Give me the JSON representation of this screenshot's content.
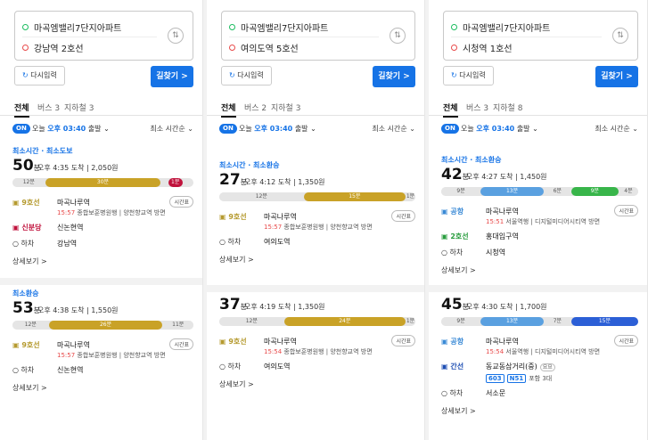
{
  "common": {
    "reset_label": "다시입력",
    "search_label": "길찾기 >",
    "swap_icon": "swap-icon",
    "on_badge": "ON",
    "today_prefix": "오늘",
    "depart_time": "오후 03:40",
    "depart_suffix": "출발",
    "sort_label": "최소 시간순",
    "tab_all": "전체",
    "timetable": "시간표",
    "more": "상세보기",
    "walk_off": "하차"
  },
  "panels": [
    {
      "origin": "마곡엠밸리7단지아파트",
      "destination": "강남역 2호선",
      "tabs": [
        "버스 3",
        "지하철 3"
      ],
      "routes": [
        {
          "tag": "최소시간 · 최소도보",
          "minutes": "50",
          "min_unit": "분",
          "arrive": "오후 4:35 도착",
          "fare": "2,050원",
          "segments": [
            {
              "label": "12분",
              "kind": "walk",
              "from": 0.0,
              "to": 0.18
            },
            {
              "label": "30분",
              "kind": "line9",
              "from": 0.18,
              "to": 0.82
            },
            {
              "label": "1분",
              "kind": "sinbundang",
              "from": 0.86,
              "to": 0.94
            }
          ],
          "steps": [
            {
              "line": "9호선",
              "color": "#b59a2f",
              "name": "마곡나루역",
              "arrive": "15:57",
              "desc": "종합보훈병원행",
              "desc2": "양천향교역 방면",
              "timetable": true
            },
            {
              "line": "신분당",
              "color": "#c0123c",
              "name": "신논현역"
            },
            {
              "line": "하차",
              "name": "강남역",
              "off": true
            }
          ]
        },
        {
          "tag": "최소환승",
          "minutes": "53",
          "min_unit": "분",
          "arrive": "오후 4:38 도착",
          "fare": "1,550원",
          "segments": [
            {
              "label": "12분",
              "kind": "walk",
              "from": 0.0,
              "to": 0.2
            },
            {
              "label": "26분",
              "kind": "line9",
              "from": 0.2,
              "to": 0.83
            },
            {
              "label": "11분",
              "kind": "walk",
              "from": 0.83,
              "to": 1.0
            }
          ],
          "steps": [
            {
              "line": "9호선",
              "color": "#b59a2f",
              "name": "마곡나루역",
              "arrive": "15:57",
              "desc": "종합보훈병원행",
              "desc2": "양천향교역 방면",
              "timetable": true
            },
            {
              "line": "하차",
              "name": "신논현역",
              "off": true
            }
          ]
        }
      ]
    },
    {
      "origin": "마곡엠밸리7단지아파트",
      "destination": "여의도역 5호선",
      "tabs": [
        "버스 2",
        "지하철 3"
      ],
      "routes": [
        {
          "tag": "최소시간 · 최소환승",
          "minutes": "27",
          "min_unit": "분",
          "arrive": "오후 4:12 도착",
          "fare": "1,350원",
          "segments": [
            {
              "label": "12분",
              "kind": "walk",
              "from": 0.0,
              "to": 0.43
            },
            {
              "label": "15분",
              "kind": "line9",
              "from": 0.43,
              "to": 0.95
            },
            {
              "label": "1분",
              "kind": "walk",
              "from": 0.95,
              "to": 1.0
            }
          ],
          "steps": [
            {
              "line": "9호선",
              "color": "#b59a2f",
              "name": "마곡나루역",
              "arrive": "15:57",
              "desc": "종합보훈병원행",
              "desc2": "양천향교역 방면",
              "timetable": true
            },
            {
              "line": "하차",
              "name": "여의도역",
              "off": true
            }
          ]
        },
        {
          "tag": "",
          "minutes": "37",
          "min_unit": "분",
          "arrive": "오후 4:19 도착",
          "fare": "1,350원",
          "segments": [
            {
              "label": "12분",
              "kind": "walk",
              "from": 0.0,
              "to": 0.33
            },
            {
              "label": "24분",
              "kind": "line9",
              "from": 0.33,
              "to": 0.95
            },
            {
              "label": "1분",
              "kind": "walk",
              "from": 0.95,
              "to": 1.0
            }
          ],
          "steps": [
            {
              "line": "9호선",
              "color": "#b59a2f",
              "name": "마곡나루역",
              "arrive": "15:54",
              "desc": "종합보훈병원행",
              "desc2": "양천향교역 방면",
              "timetable": true
            },
            {
              "line": "하차",
              "name": "여의도역",
              "off": true
            }
          ]
        }
      ]
    },
    {
      "origin": "마곡엠밸리7단지아파트",
      "destination": "시청역 1호선",
      "tabs": [
        "버스 3",
        "지하철 8"
      ],
      "routes": [
        {
          "tag": "최소시간 · 최소환승",
          "minutes": "42",
          "min_unit": "분",
          "arrive": "오후 4:27 도착",
          "fare": "1,450원",
          "segments": [
            {
              "label": "9분",
              "kind": "walk",
              "from": 0.0,
              "to": 0.2
            },
            {
              "label": "13분",
              "kind": "airport",
              "from": 0.2,
              "to": 0.52
            },
            {
              "label": "6분",
              "kind": "walk",
              "from": 0.52,
              "to": 0.66
            },
            {
              "label": "9분",
              "kind": "line2",
              "from": 0.66,
              "to": 0.9
            },
            {
              "label": "4분",
              "kind": "walk",
              "from": 0.9,
              "to": 1.0
            }
          ],
          "steps": [
            {
              "line": "공항",
              "color": "#3a8ad6",
              "name": "마곡나루역",
              "arrive": "15:51",
              "desc": "서울역행",
              "desc2": "디지털미디어시티역 방면",
              "timetable": true
            },
            {
              "line": "2호선",
              "color": "#2a9d3f",
              "name": "홍대입구역"
            },
            {
              "line": "하차",
              "name": "시청역",
              "off": true
            }
          ]
        },
        {
          "tag": "",
          "minutes": "45",
          "min_unit": "분",
          "arrive": "오후 4:30 도착",
          "fare": "1,700원",
          "segments": [
            {
              "label": "9분",
              "kind": "walk",
              "from": 0.0,
              "to": 0.2
            },
            {
              "label": "13분",
              "kind": "airport",
              "from": 0.2,
              "to": 0.52
            },
            {
              "label": "7분",
              "kind": "walk",
              "from": 0.52,
              "to": 0.66
            },
            {
              "label": "15분",
              "kind": "bus",
              "from": 0.66,
              "to": 1.0
            }
          ],
          "steps": [
            {
              "line": "공항",
              "color": "#3a8ad6",
              "name": "마곡나루역",
              "arrive": "15:54",
              "desc": "서울역행",
              "desc2": "디지털미디어시티역 방면",
              "timetable": true
            },
            {
              "line": "간선",
              "color": "#1f4fb3",
              "name": "동교동삼거리(중)",
              "name_tag": "요요",
              "buses": [
                "603",
                "N51"
              ],
              "bus_note": "포함 3대"
            },
            {
              "line": "하차",
              "name": "서소문",
              "off": true
            }
          ]
        }
      ]
    }
  ],
  "colors": {
    "walk": "#e5e5e5",
    "line9": "#c9a227",
    "sinbundang": "#c0123c",
    "airport": "#5aa0e0",
    "line2": "#38b54a",
    "bus": "#2c5fd6",
    "accent": "#1673e6"
  }
}
